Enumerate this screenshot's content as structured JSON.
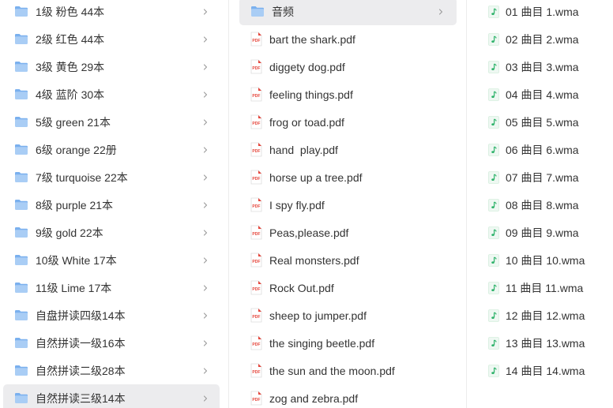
{
  "colors": {
    "folder_light": "#A9CDF5",
    "folder_dark": "#7AB0EE",
    "pdf_red": "#E5453B",
    "audio_green": "#2FB36B",
    "selected_bg": "#ECECEE",
    "chevron": "#9A9A9A"
  },
  "icons": {
    "folder": "folder-icon",
    "pdf": "pdf-file-icon",
    "audio": "audio-file-icon",
    "chevron": "chevron-right-icon"
  },
  "column1": {
    "selected_index": 13,
    "items": [
      "1级 粉色 44本",
      "2级 红色 44本",
      "3级 黄色 29本",
      "4级 蓝阶 30本",
      "5级 green 21本",
      "6级 orange 22册",
      "7级 turquoise 22本",
      "8级 purple 21本",
      "9级 gold 22本",
      "10级 White 17本",
      "11级 Lime 17本",
      "自盘拼读四级14本",
      "自然拼读一级16本",
      "自然拼读二级28本",
      "自然拼读三级14本"
    ]
  },
  "column2": {
    "selected_index": 0,
    "folder": {
      "label": "音频"
    },
    "files": [
      "bart the shark.pdf",
      "diggety dog.pdf",
      "feeling things.pdf",
      "frog or toad.pdf",
      "hand  play.pdf",
      "horse up a tree.pdf",
      "I spy fly.pdf",
      "Peas,please.pdf",
      "Real monsters.pdf",
      "Rock Out.pdf",
      "sheep to jumper.pdf",
      "the singing beetle.pdf",
      "the sun and the moon.pdf",
      "zog and zebra.pdf"
    ]
  },
  "column3": {
    "files": [
      "01 曲目 1.wma",
      "02 曲目 2.wma",
      "03 曲目 3.wma",
      "04 曲目 4.wma",
      "05 曲目 5.wma",
      "06 曲目 6.wma",
      "07 曲目 7.wma",
      "08 曲目 8.wma",
      "09 曲目 9.wma",
      "10 曲目 10.wma",
      "11 曲目 11.wma",
      "12 曲目 12.wma",
      "13 曲目 13.wma",
      "14 曲目 14.wma"
    ]
  }
}
